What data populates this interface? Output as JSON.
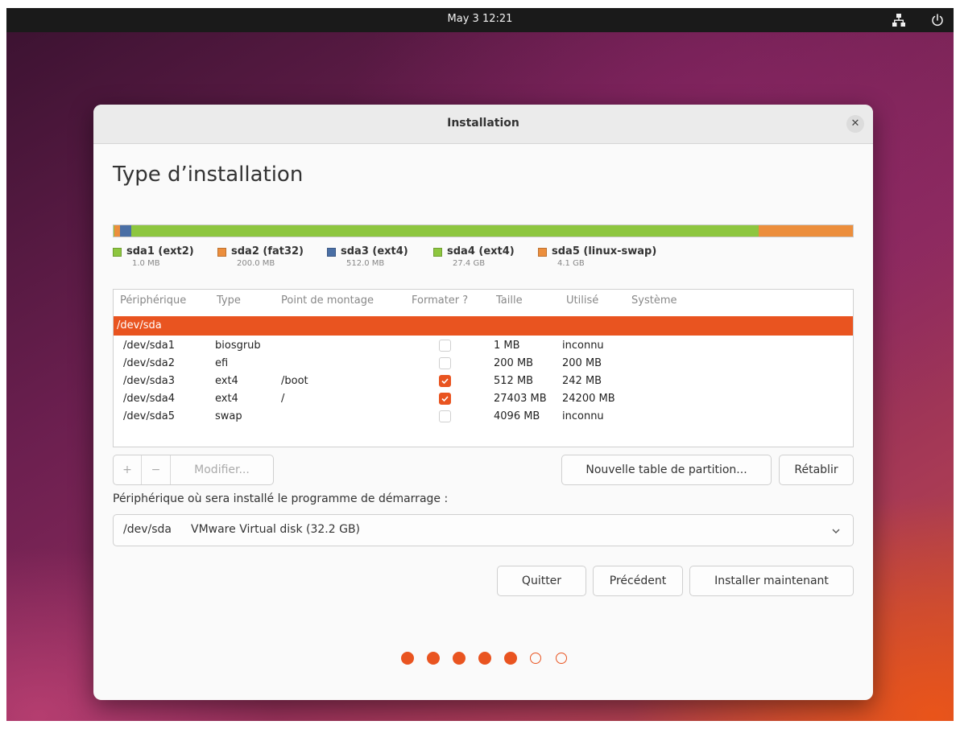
{
  "topbar": {
    "clock": "May 3  12:21",
    "icons": [
      "network-icon",
      "power-icon"
    ]
  },
  "window": {
    "title": "Installation",
    "close_icon": "close-icon"
  },
  "page": {
    "title": "Type d’installation"
  },
  "partition_bar": {
    "segments": [
      {
        "name": "sda1",
        "fraction": 0.001,
        "color": "#8dc63f"
      },
      {
        "name": "sda2",
        "fraction": 0.0075,
        "color": "#ec8e3c"
      },
      {
        "name": "sda3",
        "fraction": 0.016,
        "color": "#4a6fa5"
      },
      {
        "name": "sda4",
        "fraction": 0.848,
        "color": "#8dc63f"
      },
      {
        "name": "sda5",
        "fraction": 0.127,
        "color": "#ec8e3c"
      }
    ]
  },
  "legend": [
    {
      "name": "sda1 (ext2)",
      "size": "1.0 MB",
      "color": "#8dc63f"
    },
    {
      "name": "sda2 (fat32)",
      "size": "200.0 MB",
      "color": "#ec8e3c"
    },
    {
      "name": "sda3 (ext4)",
      "size": "512.0 MB",
      "color": "#4a6fa5"
    },
    {
      "name": "sda4 (ext4)",
      "size": "27.4 GB",
      "color": "#8dc63f"
    },
    {
      "name": "sda5 (linux-swap)",
      "size": "4.1 GB",
      "color": "#ec8e3c"
    }
  ],
  "table": {
    "headers": [
      "Périphérique",
      "Type",
      "Point de montage",
      "Formater ?",
      "Taille",
      "Utilisé",
      "Système"
    ],
    "device_row": "/dev/sda",
    "rows": [
      {
        "device": "/dev/sda1",
        "type": "biosgrub",
        "mount": "",
        "format": false,
        "size": "1 MB",
        "used": "inconnu"
      },
      {
        "device": "/dev/sda2",
        "type": "efi",
        "mount": "",
        "format": false,
        "size": "200 MB",
        "used": "200 MB"
      },
      {
        "device": "/dev/sda3",
        "type": "ext4",
        "mount": "/boot",
        "format": true,
        "size": "512 MB",
        "used": "242 MB"
      },
      {
        "device": "/dev/sda4",
        "type": "ext4",
        "mount": "/",
        "format": true,
        "size": "27403 MB",
        "used": "24200 MB"
      },
      {
        "device": "/dev/sda5",
        "type": "swap",
        "mount": "",
        "format": false,
        "size": "4096 MB",
        "used": "inconnu"
      }
    ]
  },
  "toolbar": {
    "add": "+",
    "remove": "−",
    "modify": "Modifier...",
    "new_table": "Nouvelle table de partition...",
    "revert": "Rétablir"
  },
  "bootloader": {
    "label": "Périphérique où sera installé le programme de démarrage :",
    "device": "/dev/sda",
    "description": "VMware Virtual disk (32.2 GB)"
  },
  "actions": {
    "quit": "Quitter",
    "back": "Précédent",
    "install": "Installer maintenant"
  },
  "progress": {
    "total": 7,
    "completed": 5
  },
  "colors": {
    "accent": "#e95420",
    "topbar": "#1a1a1a"
  }
}
